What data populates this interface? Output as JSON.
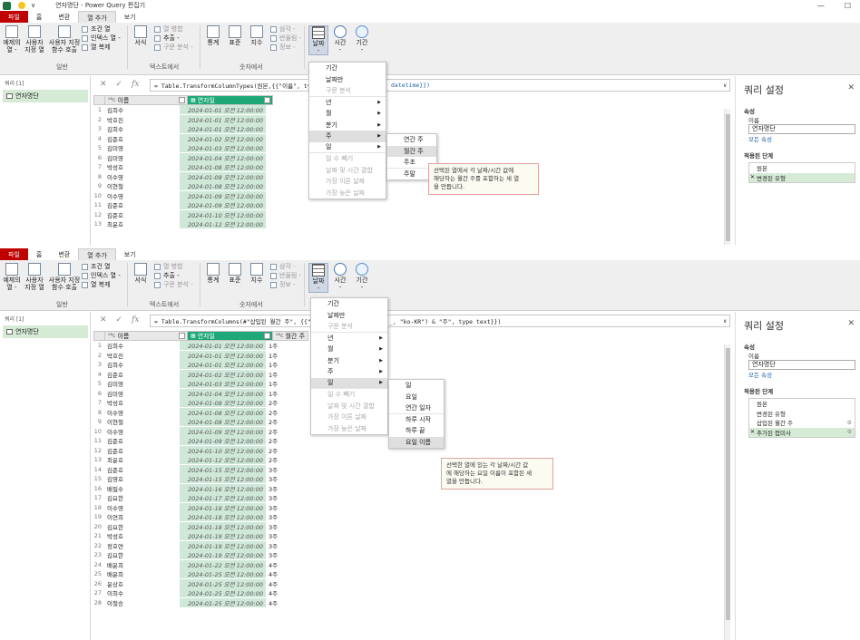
{
  "window": {
    "title": "연자명단 - Power Query 편집기",
    "qat_label": "∨"
  },
  "tabs": [
    "파일",
    "홈",
    "변환",
    "열 추가",
    "보기"
  ],
  "ribbon": {
    "example_col": "예제의\n열 -",
    "custom_col": "사용자\n지정 열",
    "invoke_fn": "사용자 지정\n함수 호출",
    "cond_col": "조건 열",
    "index_col": "인덱스 열 -",
    "dup_col": "열 복제",
    "group_general": "일반",
    "format": "서식",
    "merge_col": "열 병합",
    "extract": "추출 -",
    "parse": "구문 분석 -",
    "group_text": "텍스트에서",
    "stats": "통계",
    "standard": "표준",
    "sci": "지수",
    "trig": "삼각 -",
    "rounding": "반올림 -",
    "info": "정보 -",
    "group_number": "숫자에서",
    "date": "날짜\n-",
    "time": "시간\n-",
    "duration": "기간\n-"
  },
  "left_pane": {
    "title": "쿼리 [1]",
    "query": "연자명단"
  },
  "panel1": {
    "formula": "= Table.TransformColumnTypes(원본,{{\"이름\", type",
    "formula_tail": "datetime}})",
    "col_name": "이름",
    "col_date": "연자일",
    "rows": [
      [
        "1",
        "김희수",
        "2024-01-01 오전 12:00:00"
      ],
      [
        "2",
        "박호진",
        "2024-01-01 오전 12:00:00"
      ],
      [
        "3",
        "김희수",
        "2024-01-01 오전 12:00:00"
      ],
      [
        "4",
        "김준호",
        "2024-01-02 오전 12:00:00"
      ],
      [
        "5",
        "김미영",
        "2024-01-03 오전 12:00:00"
      ],
      [
        "6",
        "김미영",
        "2024-01-04 오전 12:00:00"
      ],
      [
        "7",
        "박성호",
        "2024-01-08 오전 12:00:00"
      ],
      [
        "8",
        "이수영",
        "2024-01-08 오전 12:00:00"
      ],
      [
        "9",
        "이현철",
        "2024-01-08 오전 12:00:00"
      ],
      [
        "10",
        "이수영",
        "2024-01-09 오전 12:00:00"
      ],
      [
        "11",
        "김준호",
        "2024-01-09 오전 12:00:00"
      ],
      [
        "12",
        "김준호",
        "2024-01-10 오전 12:00:00"
      ],
      [
        "13",
        "최윤호",
        "2024-01-12 오전 12:00:00"
      ]
    ],
    "date_menu": [
      {
        "label": "기간",
        "sub": false,
        "dim": false
      },
      {
        "label": "날짜만",
        "sub": false,
        "dim": false
      },
      {
        "label": "구문 분석",
        "sub": false,
        "dim": true
      },
      {
        "label": "년",
        "sub": true,
        "dim": false
      },
      {
        "label": "월",
        "sub": true,
        "dim": false
      },
      {
        "label": "분기",
        "sub": true,
        "dim": false
      },
      {
        "label": "주",
        "sub": true,
        "dim": false,
        "hov": true
      },
      {
        "label": "일",
        "sub": true,
        "dim": false
      },
      {
        "label": "일 수 빼기",
        "sub": false,
        "dim": true
      },
      {
        "label": "날짜 및 시간 결합",
        "sub": false,
        "dim": true
      },
      {
        "label": "가장 이른 날짜",
        "sub": false,
        "dim": true
      },
      {
        "label": "가장 늦은 날짜",
        "sub": false,
        "dim": true
      }
    ],
    "week_menu": [
      {
        "label": "연간 주",
        "hov": false
      },
      {
        "label": "월간 주",
        "hov": true
      },
      {
        "label": "주초",
        "hov": false
      },
      {
        "label": "주말",
        "hov": false
      }
    ],
    "tooltip": "선택된 열에서 각 날짜/시간 값에\n해당하는 월간 주를 포함하는 새 열\n을 만듭니다.",
    "settings": {
      "title": "쿼리 설정",
      "props": "속성",
      "name_label": "이름",
      "name_value": "연자명단",
      "all_props": "모든 속성",
      "steps_label": "적용된 단계",
      "steps": [
        {
          "label": "원본",
          "sel": false
        },
        {
          "label": "변경된 유형",
          "sel": true,
          "x": true
        }
      ]
    }
  },
  "panel2": {
    "formula": "= Table.TransformColumns(#\"삽입된 월간 주\", {{\"",
    "formula_tail": "_, \"ko-KR\") & \"주\", type text}})",
    "col_name": "이름",
    "col_date": "연자일",
    "col_week": "월간 주",
    "rows": [
      [
        "1",
        "김희수",
        "2024-01-01 오전 12:00:00",
        "1주"
      ],
      [
        "2",
        "박호진",
        "2024-01-01 오전 12:00:00",
        "1주"
      ],
      [
        "3",
        "김희수",
        "2024-01-01 오전 12:00:00",
        "1주"
      ],
      [
        "4",
        "김준호",
        "2024-01-02 오전 12:00:00",
        "1주"
      ],
      [
        "5",
        "김미영",
        "2024-01-03 오전 12:00:00",
        "1주"
      ],
      [
        "6",
        "김미영",
        "2024-01-04 오전 12:00:00",
        "1주"
      ],
      [
        "7",
        "박성호",
        "2024-01-08 오전 12:00:00",
        "2주"
      ],
      [
        "8",
        "이수영",
        "2024-01-08 오전 12:00:00",
        "2주"
      ],
      [
        "9",
        "이현철",
        "2024-01-08 오전 12:00:00",
        "2주"
      ],
      [
        "10",
        "이수영",
        "2024-01-09 오전 12:00:00",
        "2주"
      ],
      [
        "11",
        "김준호",
        "2024-01-09 오전 12:00:00",
        "2주"
      ],
      [
        "12",
        "김준호",
        "2024-01-10 오전 12:00:00",
        "2주"
      ],
      [
        "13",
        "최윤호",
        "2024-01-12 오전 12:00:00",
        "2주"
      ],
      [
        "14",
        "김준호",
        "2024-01-15 오전 12:00:00",
        "3주"
      ],
      [
        "15",
        "김영호",
        "2024-01-15 오전 12:00:00",
        "3주"
      ],
      [
        "16",
        "배필수",
        "2024-01-16 오전 12:00:00",
        "3주"
      ],
      [
        "17",
        "김요한",
        "2024-01-17 오전 12:00:00",
        "3주"
      ],
      [
        "18",
        "이수영",
        "2024-01-18 오전 12:00:00",
        "3주"
      ],
      [
        "19",
        "이연희",
        "2024-01-18 오전 12:00:00",
        "3주"
      ],
      [
        "20",
        "김요한",
        "2024-01-18 오전 12:00:00",
        "3주"
      ],
      [
        "21",
        "박성호",
        "2024-01-19 오전 12:00:00",
        "3주"
      ],
      [
        "22",
        "정호연",
        "2024-01-19 오전 12:00:00",
        "3주"
      ],
      [
        "23",
        "김요한",
        "2024-01-19 오전 12:00:00",
        "3주"
      ],
      [
        "24",
        "배윤희",
        "2024-01-22 오전 12:00:00",
        "4주"
      ],
      [
        "25",
        "배윤희",
        "2024-01-25 오전 12:00:00",
        "4주"
      ],
      [
        "26",
        "윤상호",
        "2024-01-25 오전 12:00:00",
        "4주"
      ],
      [
        "27",
        "이희수",
        "2024-01-25 오전 12:00:00",
        "4주"
      ],
      [
        "28",
        "이철승",
        "2024-01-25 오전 12:00:00",
        "4주"
      ]
    ],
    "date_menu": [
      {
        "label": "기간",
        "sub": false,
        "dim": false
      },
      {
        "label": "날짜만",
        "sub": false,
        "dim": false
      },
      {
        "label": "구문 분석",
        "sub": false,
        "dim": true
      },
      {
        "label": "년",
        "sub": true,
        "dim": false
      },
      {
        "label": "월",
        "sub": true,
        "dim": false
      },
      {
        "label": "분기",
        "sub": true,
        "dim": false
      },
      {
        "label": "주",
        "sub": true,
        "dim": false
      },
      {
        "label": "일",
        "sub": true,
        "dim": false,
        "hov": true
      },
      {
        "label": "일 수 빼기",
        "sub": false,
        "dim": true
      },
      {
        "label": "날짜 및 시간 결합",
        "sub": false,
        "dim": true
      },
      {
        "label": "가장 이른 날짜",
        "sub": false,
        "dim": true
      },
      {
        "label": "가장 늦은 날짜",
        "sub": false,
        "dim": true
      }
    ],
    "day_menu": [
      {
        "label": "일",
        "hov": false
      },
      {
        "label": "요일",
        "hov": false
      },
      {
        "label": "연간 일자",
        "hov": false
      },
      {
        "label": "하루 시작",
        "hov": false
      },
      {
        "label": "하루 끝",
        "hov": false
      },
      {
        "label": "요일 이름",
        "hov": true
      }
    ],
    "tooltip": "선택한 열에 있는 각 날짜/시간 값\n에 해당하는 요일 이름이 포함된 새\n열을 만듭니다.",
    "settings": {
      "title": "쿼리 설정",
      "props": "속성",
      "name_label": "이름",
      "name_value": "연자명단",
      "all_props": "모든 속성",
      "steps_label": "적용된 단계",
      "steps": [
        {
          "label": "원본",
          "sel": false
        },
        {
          "label": "변경된 유형",
          "sel": false
        },
        {
          "label": "삽입된 월간 주",
          "sel": false,
          "gear": true
        },
        {
          "label": "추가된 접미사",
          "sel": true,
          "x": true,
          "gear": true
        }
      ]
    }
  }
}
